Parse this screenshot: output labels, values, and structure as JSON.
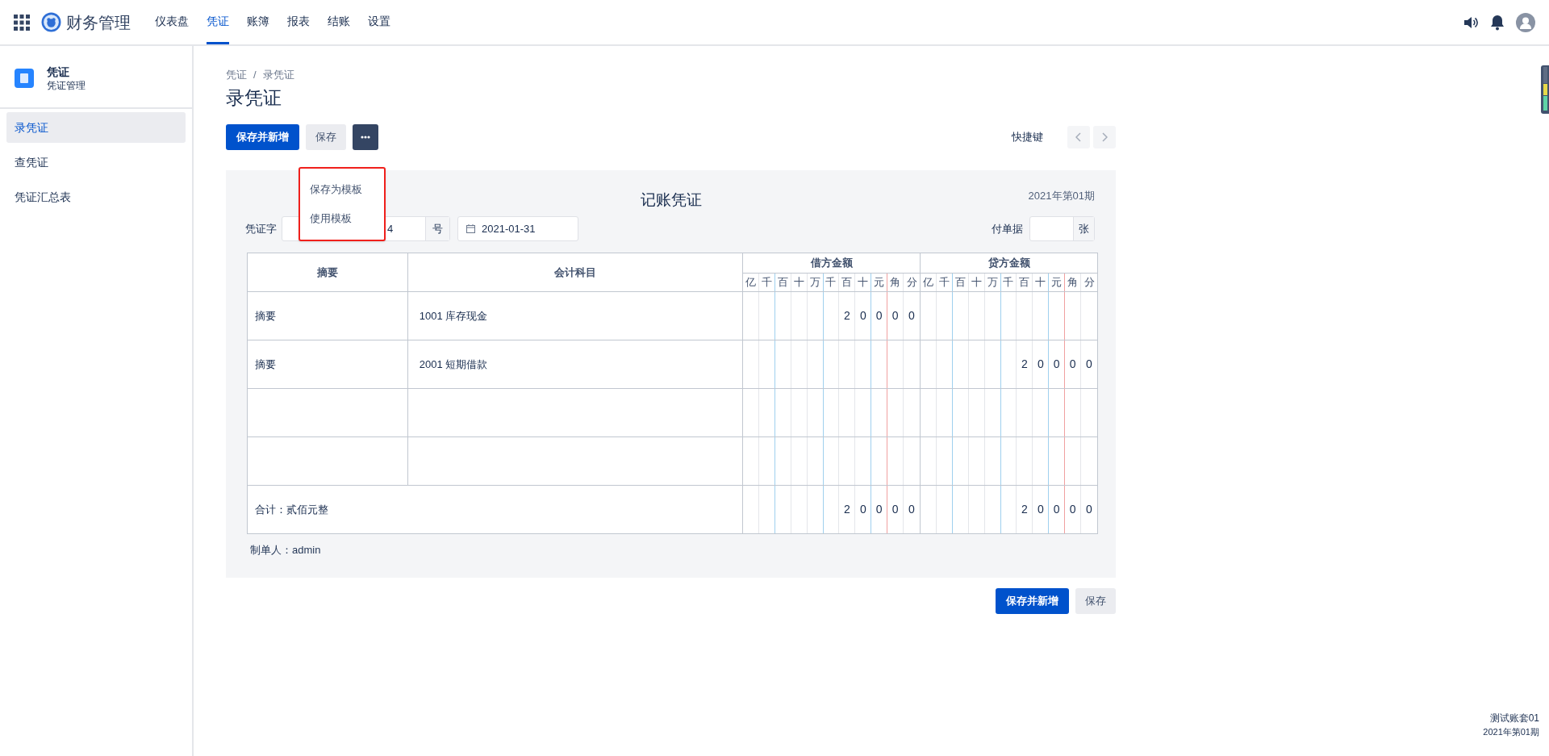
{
  "app": {
    "name": "财务管理"
  },
  "nav": [
    {
      "label": "仪表盘",
      "selected": false
    },
    {
      "label": "凭证",
      "selected": true
    },
    {
      "label": "账簿",
      "selected": false
    },
    {
      "label": "报表",
      "selected": false
    },
    {
      "label": "结账",
      "selected": false
    },
    {
      "label": "设置",
      "selected": false
    }
  ],
  "sidebar": {
    "title": "凭证",
    "subtitle": "凭证管理",
    "items": [
      {
        "label": "录凭证",
        "selected": true
      },
      {
        "label": "查凭证",
        "selected": false
      },
      {
        "label": "凭证汇总表",
        "selected": false
      }
    ]
  },
  "breadcrumb": [
    "凭证",
    "录凭证"
  ],
  "breadcrumb_separator": "/",
  "page_title": "录凭证",
  "toolbar": {
    "buttons": [
      {
        "label": "保存并新增",
        "kind": "primary"
      },
      {
        "label": "保存",
        "kind": "secondary"
      },
      {
        "kind": "more"
      }
    ],
    "shortcut": "快捷键"
  },
  "menu": {
    "items": [
      "保存为模板",
      "使用模板"
    ]
  },
  "voucher": {
    "title": "记账凭证",
    "period": "2021年第01期",
    "type_label": "凭证字",
    "number": "4",
    "number_suffix": "号",
    "date": "2021-01-31",
    "attach_label": "付单据",
    "attach_unit": "张"
  },
  "table": {
    "columns": [
      "摘要",
      "会计科目"
    ],
    "debit_label": "借方金额",
    "credit_label": "贷方金额",
    "debit_digits": [
      "亿",
      "千",
      "百",
      "十",
      "万",
      "千",
      "百",
      "十",
      "元",
      "角",
      "分"
    ],
    "credit_digits": [
      "亿",
      "千",
      "百",
      "十",
      "万",
      "千",
      "百",
      "十",
      "元",
      "角",
      "分"
    ],
    "rows": [
      {
        "kind": "entry",
        "summary": "摘要",
        "account": "1001 库存现金",
        "debit": [
          "2",
          "0",
          "0",
          "0",
          "0"
        ]
      },
      {
        "kind": "entry",
        "summary": "摘要",
        "account": "2001 短期借款",
        "credit": [
          "2",
          "0",
          "0",
          "0",
          "0"
        ]
      },
      {
        "kind": "blank"
      },
      {
        "kind": "blank"
      }
    ],
    "total": {
      "label": "合计：贰佰元整",
      "debit": [
        "2",
        "0",
        "0",
        "0",
        "0"
      ],
      "credit": [
        "2",
        "0",
        "0",
        "0",
        "0"
      ]
    }
  },
  "creator": "制单人：admin",
  "footer_buttons": [
    {
      "label": "保存并新增",
      "kind": "primary"
    },
    {
      "label": "保存",
      "kind": "secondary"
    }
  ],
  "account": {
    "name": "测试账套01",
    "period": "2021年第01期"
  }
}
